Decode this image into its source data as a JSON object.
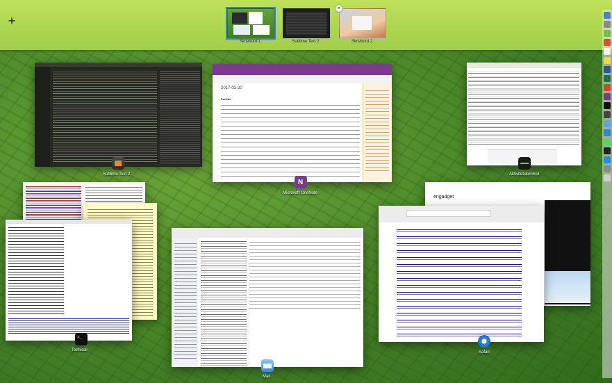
{
  "spaces": {
    "add_label": "+",
    "items": [
      {
        "label": "Skrivbord 1",
        "selected": true
      },
      {
        "label": "Sublime Text 2"
      },
      {
        "label": "Skrivbord 2"
      }
    ],
    "close_label": "×"
  },
  "windows": {
    "sublime": {
      "app_label": "Sublime Text 2"
    },
    "onenote": {
      "app_label": "Microsoft OneNote",
      "date": "2017-02-20",
      "heading": "Punkter"
    },
    "activity": {
      "app_label": "Aktivitetskontroll"
    },
    "terminal": {
      "app_label": "Terminal"
    },
    "mail": {
      "app_label": "Mail"
    },
    "safari": {
      "app_label": "Safari"
    },
    "engadget": {
      "title": "engadget"
    }
  },
  "colors": {
    "accent": "#2f86d6",
    "desktop_bar": "#a8d44e"
  }
}
